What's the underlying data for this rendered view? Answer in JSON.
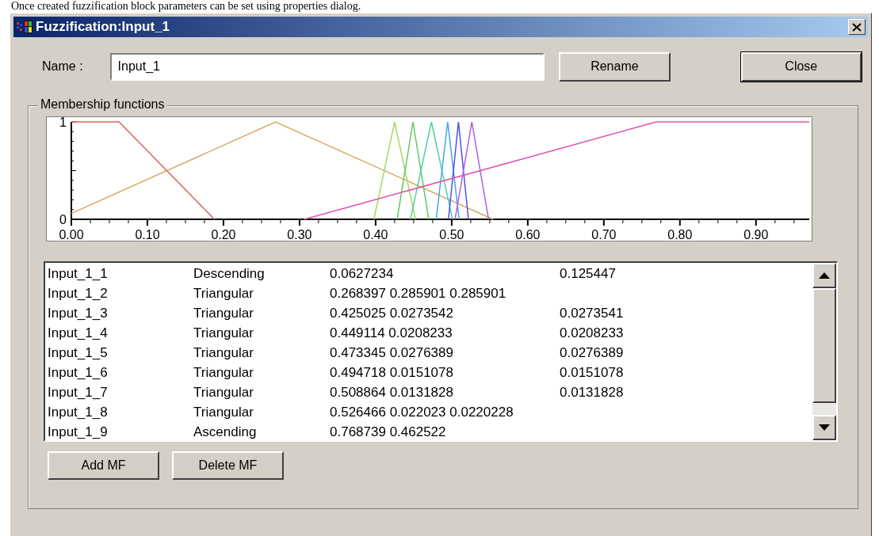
{
  "caption": "Once created fuzzification block parameters can be set using properties dialog.",
  "window": {
    "title": "Fuzzification:Input_1"
  },
  "name_field": {
    "label": "Name :",
    "value": "Input_1"
  },
  "top_buttons": [
    {
      "label": "Rename"
    },
    {
      "label": "Close"
    }
  ],
  "membership_functions": {
    "title": "Membership functions",
    "chart_data": {
      "type": "line",
      "xlim": [
        0,
        0.97
      ],
      "ylim": [
        0,
        1
      ],
      "xticks": [
        {
          "value": 0,
          "label": "0.00"
        },
        {
          "value": 0.1,
          "label": "0.10"
        },
        {
          "value": 0.2,
          "label": "0.20"
        },
        {
          "value": 0.3,
          "label": "0.30"
        },
        {
          "value": 0.4,
          "label": "0.40"
        },
        {
          "value": 0.5,
          "label": "0.50"
        },
        {
          "value": 0.6,
          "label": "0.60"
        },
        {
          "value": 0.7,
          "label": "0.70"
        },
        {
          "value": 0.8,
          "label": "0.80"
        },
        {
          "value": 0.9,
          "label": "0.90"
        }
      ],
      "yticks": [
        0,
        1
      ],
      "series": [
        {
          "color": "#e06060",
          "x": [
            0,
            0.0627,
            0.1882
          ],
          "values": [
            1,
            1,
            0
          ]
        },
        {
          "color": "#d8a860",
          "x": [
            0,
            0.2684,
            0.5543
          ],
          "values": [
            0.06,
            1,
            0
          ]
        },
        {
          "color": "#a8d860",
          "x": [
            0.3977,
            0.425,
            0.4524
          ],
          "values": [
            0,
            1,
            0
          ]
        },
        {
          "color": "#60c860",
          "x": [
            0.4283,
            0.4491,
            0.4699
          ],
          "values": [
            0,
            1,
            0
          ]
        },
        {
          "color": "#50d0a8",
          "x": [
            0.4457,
            0.4733,
            0.501
          ],
          "values": [
            0,
            1,
            0
          ]
        },
        {
          "color": "#40a8e0",
          "x": [
            0.4796,
            0.4947,
            0.5098
          ],
          "values": [
            0,
            1,
            0
          ]
        },
        {
          "color": "#5050e0",
          "x": [
            0.4957,
            0.5089,
            0.522
          ],
          "values": [
            0,
            1,
            0
          ]
        },
        {
          "color": "#b060e0",
          "x": [
            0.5044,
            0.5265,
            0.5485
          ],
          "values": [
            0,
            1,
            0
          ]
        },
        {
          "color": "#e050b0",
          "x": [
            0.3062,
            0.7687,
            0.97
          ],
          "values": [
            0,
            1,
            1
          ]
        }
      ]
    },
    "rows": [
      {
        "name": "Input_1_1",
        "type": "Descending",
        "params": "0.0627234",
        "extra": "0.125447"
      },
      {
        "name": "Input_1_2",
        "type": "Triangular",
        "params": "0.268397 0.285901 0.285901"
      },
      {
        "name": "Input_1_3",
        "type": "Triangular",
        "params": "0.425025 0.0273542",
        "extra": "0.0273541"
      },
      {
        "name": "Input_1_4",
        "type": "Triangular",
        "params": "0.449114 0.0208233",
        "extra": "0.0208233"
      },
      {
        "name": "Input_1_5",
        "type": "Triangular",
        "params": "0.473345 0.0276389",
        "extra": "0.0276389"
      },
      {
        "name": "Input_1_6",
        "type": "Triangular",
        "params": "0.494718 0.0151078",
        "extra": "0.0151078"
      },
      {
        "name": "Input_1_7",
        "type": "Triangular",
        "params": "0.508864 0.0131828",
        "extra": "0.0131828"
      },
      {
        "name": "Input_1_8",
        "type": "Triangular",
        "params": "0.526466 0.022023 0.0220228"
      },
      {
        "name": "Input_1_9",
        "type": "Ascending",
        "params": "0.768739 0.462522"
      }
    ],
    "buttons": [
      {
        "label": "Add MF"
      },
      {
        "label": "Delete MF"
      }
    ]
  }
}
